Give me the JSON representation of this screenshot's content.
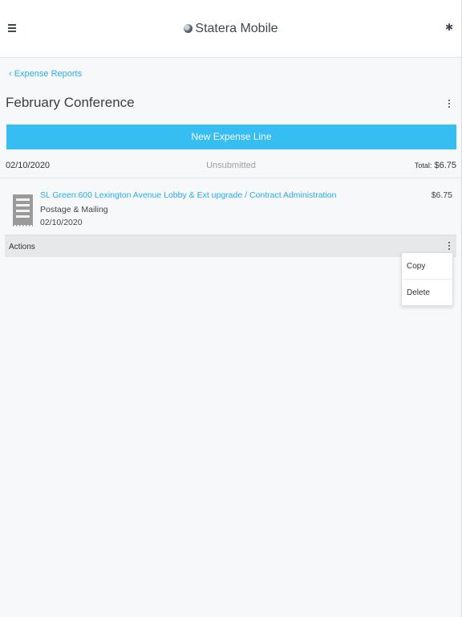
{
  "header": {
    "app_title": "Statera Mobile",
    "menu_icon": "hamburger-menu-icon",
    "settings_icon": "gear-icon"
  },
  "nav": {
    "back_label": "‹ Expense Reports"
  },
  "report": {
    "title": "February Conference",
    "new_line_button": "New Expense Line",
    "date": "02/10/2020",
    "status": "Unsubmitted",
    "total_label": "Total:",
    "total_value": "$6.75"
  },
  "expense_lines": [
    {
      "name": "SL Green:600 Lexington Avenue Lobby & Ext upgrade / Contract Administration",
      "category": "Postage & Mailing",
      "date": "02/10/2020",
      "amount": "$6.75",
      "icon": "receipt-icon"
    }
  ],
  "actions": {
    "label": "Actions",
    "menu": [
      "Copy",
      "Delete"
    ]
  },
  "colors": {
    "accent": "#36bdf2",
    "link": "#26aee8"
  }
}
